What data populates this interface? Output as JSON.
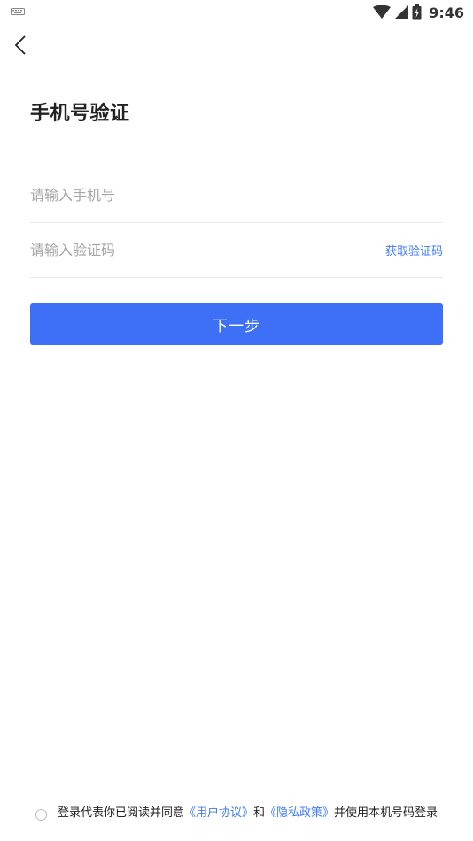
{
  "status_bar": {
    "time": "9:46",
    "icons": [
      "keyboard-icon",
      "wifi-icon",
      "signal-icon",
      "battery-icon"
    ]
  },
  "header": {
    "back_icon": "chevron-left-icon"
  },
  "page": {
    "title": "手机号验证"
  },
  "form": {
    "phone": {
      "placeholder": "请输入手机号",
      "value": ""
    },
    "code": {
      "placeholder": "请输入验证码",
      "value": ""
    },
    "get_code_label": "获取验证码",
    "next_label": "下一步"
  },
  "agreement": {
    "prefix": "登录代表你已阅读并同意",
    "user_agreement": "《用户协议》",
    "and": "和",
    "privacy_policy": "《隐私政策》",
    "suffix": "并使用本机号码登录"
  },
  "colors": {
    "primary": "#3d6ff7",
    "link": "#3d7bf5",
    "placeholder": "#a6a6a6",
    "divider": "#e8e8e8"
  }
}
